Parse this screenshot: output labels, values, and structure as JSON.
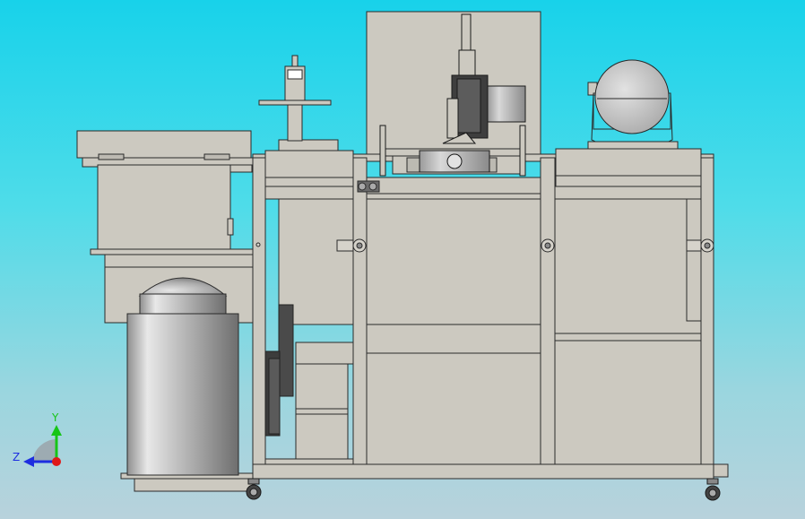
{
  "viewport": {
    "background_top": "#18d2ea",
    "background_bottom": "#b8d2dc"
  },
  "model": {
    "part_fill": "#ccc9c0",
    "edge_color": "#2a2a2a",
    "dark_fill": "#4a4a4a"
  },
  "triad": {
    "y_label": "Y",
    "z_label": "Z",
    "y_color": "#17c517",
    "z_color": "#1d2ee0",
    "origin_color": "#e01818"
  }
}
